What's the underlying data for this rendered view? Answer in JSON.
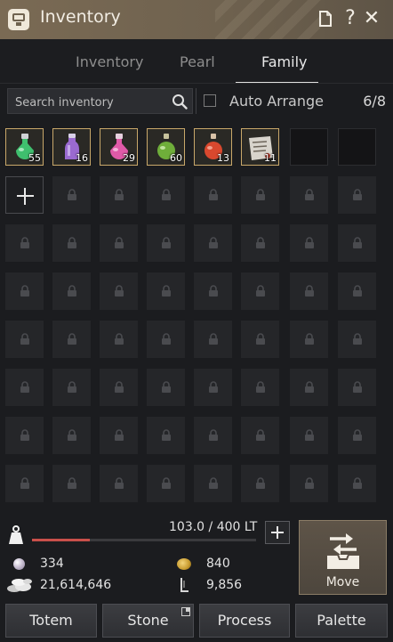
{
  "window": {
    "title": "Inventory",
    "accent": "#c9a86a"
  },
  "tabs": [
    {
      "label": "Inventory",
      "active": false
    },
    {
      "label": "Pearl",
      "active": false
    },
    {
      "label": "Family",
      "active": true
    }
  ],
  "search": {
    "placeholder": "Search inventory",
    "value": ""
  },
  "auto_arrange": {
    "label": "Auto Arrange",
    "checked": false
  },
  "slot_count": "6/8",
  "items": [
    {
      "name": "green-potion-icon",
      "qty": "55",
      "color": "#3fbf6e"
    },
    {
      "name": "purple-potion-icon",
      "qty": "16",
      "color": "#9a6ad0"
    },
    {
      "name": "pink-potion-icon",
      "qty": "29",
      "color": "#e05aa8"
    },
    {
      "name": "green-elixir-icon",
      "qty": "60",
      "color": "#6fae3a"
    },
    {
      "name": "red-potion-icon",
      "qty": "13",
      "color": "#d9482e"
    },
    {
      "name": "scroll-icon",
      "qty": "11",
      "color": "#d8d4cc"
    }
  ],
  "weight": {
    "text": "103.0 / 400 LT",
    "current": 103.0,
    "max": 400,
    "fill_fraction": 0.2575
  },
  "currency": {
    "pearls": "334",
    "silver": "21,614,646",
    "coins": "840",
    "energy": "9,856"
  },
  "move_button": {
    "label": "Move"
  },
  "buttons": {
    "totem": "Totem",
    "stone": "Stone",
    "process": "Process",
    "palette": "Palette"
  }
}
